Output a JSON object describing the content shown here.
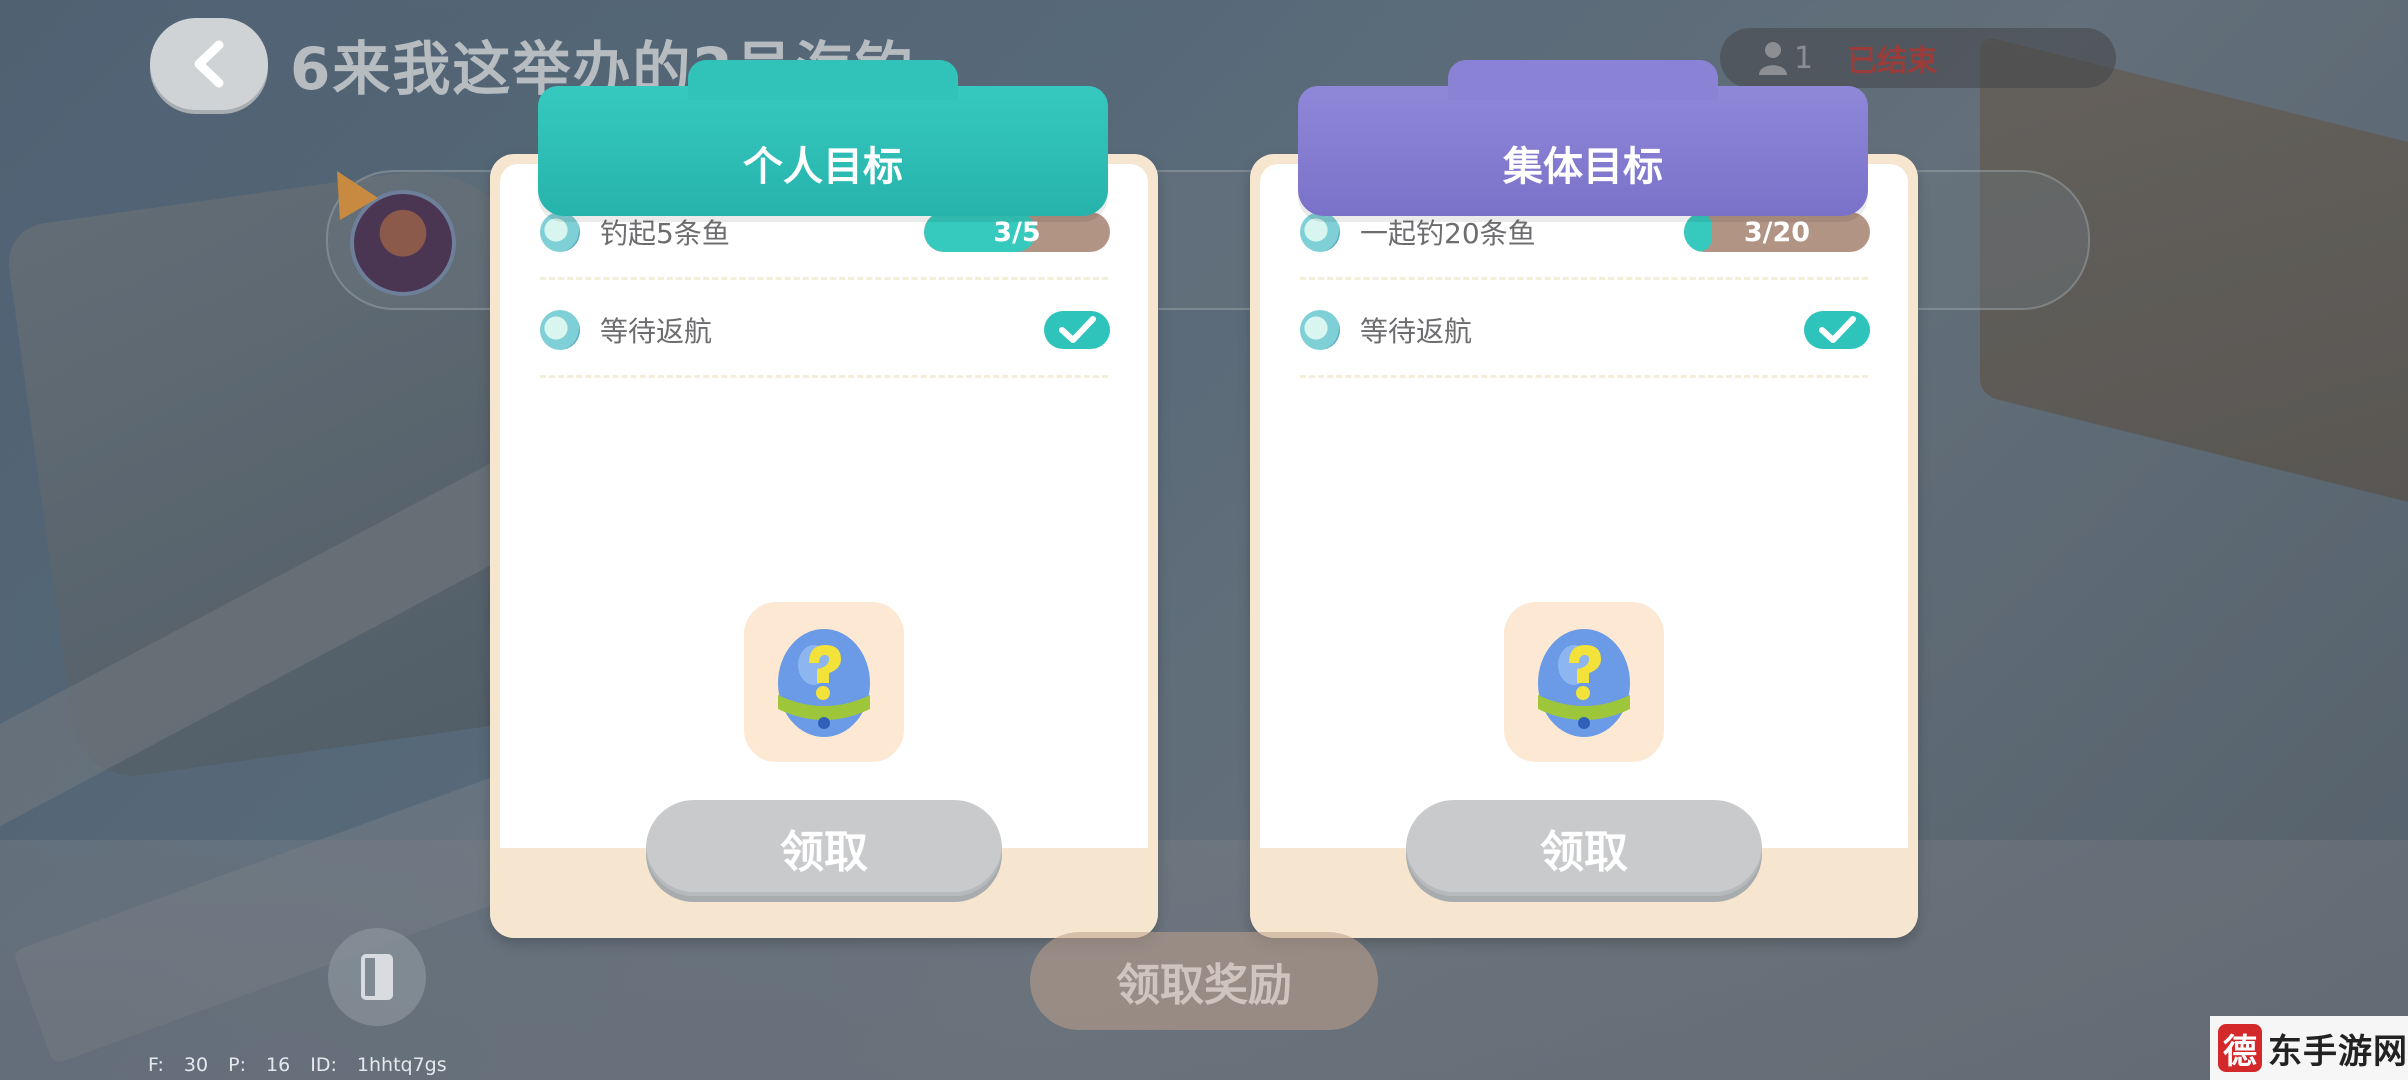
{
  "header": {
    "room_title": "6来我这举办的2号海钓",
    "player_count": "1",
    "room_status": "已结束"
  },
  "panels": [
    {
      "title": "个人目标",
      "tasks": [
        {
          "label": "钓起5条鱼",
          "progress_text": "3/5",
          "progress_fraction": 0.6,
          "completed": false
        },
        {
          "label": "等待返航",
          "completed": true
        }
      ],
      "reward_icon": "mystery-egg-icon",
      "claim_label": "领取"
    },
    {
      "title": "集体目标",
      "tasks": [
        {
          "label": "一起钓20条鱼",
          "progress_text": "3/20",
          "progress_fraction": 0.15,
          "completed": false
        },
        {
          "label": "等待返航",
          "completed": true
        }
      ],
      "reward_icon": "mystery-egg-icon",
      "claim_label": "领取"
    }
  ],
  "footer": {
    "claim_rewards_label": "领取奖励",
    "debug_text": "F: 30 P: 16 ID: 1hhtq7gs"
  },
  "watermark": {
    "logo": "德",
    "text": "东手游网"
  },
  "colors": {
    "personal_header": "#2fc1b8",
    "group_header": "#857dcf",
    "progress_fill": "#36c9bd",
    "progress_track": "#b29484",
    "claim_button_disabled": "#c8cacb",
    "status_ended": "#9a3c39"
  }
}
